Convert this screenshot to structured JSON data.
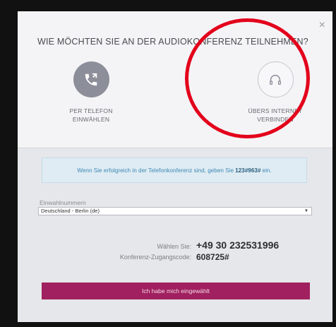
{
  "dialog": {
    "close_symbol": "×",
    "heading": "WIE MÖCHTEN SIE AN DER AUDIOKONFERENZ TEILNEHMEN?",
    "options": [
      {
        "icon": "phone-icon",
        "label_line1": "PER TELEFON",
        "label_line2": "EINWÄHLEN"
      },
      {
        "icon": "headset-icon",
        "label_line1": "ÜBERS INTERNET",
        "label_line2": "VERBINDEN"
      }
    ]
  },
  "info": {
    "text_before": "Wenn Sie erfolgreich in der Telefonkonferenz sind, geben Sie",
    "code": "123#963#",
    "text_after": "ein."
  },
  "dial_in": {
    "label": "Einwahlnummern",
    "selected": "Deutschland - Berlin (de)",
    "caret": "▼"
  },
  "details": {
    "dial_label": "Wählen Sie:",
    "dial_number": "+49 30 232531996",
    "code_label": "Konferenz-Zugangscode:",
    "code_value": "608725#"
  },
  "submit_label": "Ich habe mich eingewählt",
  "colors": {
    "accent": "#a1205f",
    "annotation": "#e3001b",
    "info_text": "#3e88b5"
  }
}
